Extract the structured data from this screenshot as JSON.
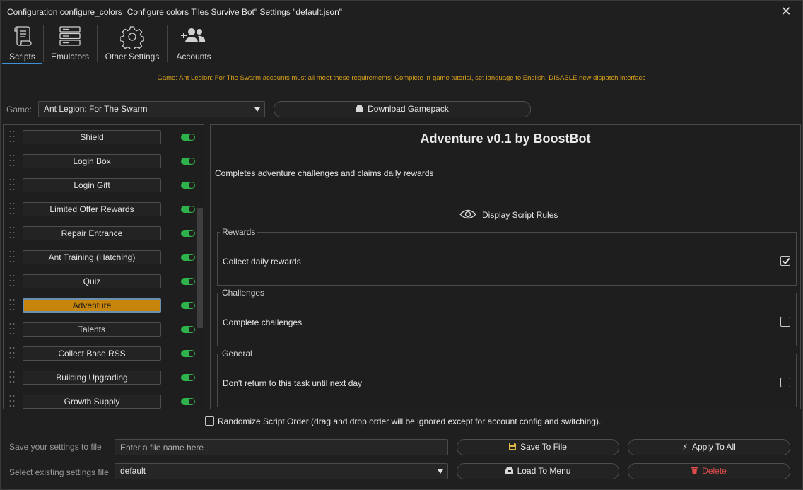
{
  "window": {
    "title": "Configuration configure_colors=Configure colors Tiles Survive Bot\" Settings \"default.json\"",
    "close_glyph": "✕"
  },
  "toolbar": {
    "items": [
      {
        "label": "Scripts",
        "icon": "scroll-icon",
        "active": true
      },
      {
        "label": "Emulators",
        "icon": "server-icon",
        "active": false
      },
      {
        "label": "Other Settings",
        "icon": "gear-icon",
        "active": false
      },
      {
        "label": "Accounts",
        "icon": "add-users-icon",
        "active": false
      }
    ]
  },
  "notice": "Game: Ant Legion: For The Swarm accounts must all meet these requirements! Complete in-game tutorial, set language to English, DISABLE new dispatch interface",
  "game": {
    "label": "Game:",
    "selected": "Ant Legion: For The Swarm",
    "download_label": "Download Gamepack"
  },
  "scripts": [
    {
      "label": "Shield",
      "enabled": true,
      "selected": false
    },
    {
      "label": "Login Box",
      "enabled": true,
      "selected": false
    },
    {
      "label": "Login Gift",
      "enabled": true,
      "selected": false
    },
    {
      "label": "Limited Offer Rewards",
      "enabled": true,
      "selected": false
    },
    {
      "label": "Repair Entrance",
      "enabled": true,
      "selected": false
    },
    {
      "label": "Ant Training (Hatching)",
      "enabled": true,
      "selected": false
    },
    {
      "label": "Quiz",
      "enabled": true,
      "selected": false
    },
    {
      "label": "Adventure",
      "enabled": true,
      "selected": true
    },
    {
      "label": "Talents",
      "enabled": true,
      "selected": false
    },
    {
      "label": "Collect Base RSS",
      "enabled": true,
      "selected": false
    },
    {
      "label": "Building Upgrading",
      "enabled": true,
      "selected": false
    },
    {
      "label": "Growth Supply",
      "enabled": true,
      "selected": false
    }
  ],
  "detail": {
    "title": "Adventure v0.1 by BoostBot",
    "description": "Completes adventure challenges and claims daily rewards",
    "rules_label": "Display Script Rules",
    "groups": [
      {
        "legend": "Rewards",
        "option": "Collect daily rewards",
        "checked": true
      },
      {
        "legend": "Challenges",
        "option": "Complete challenges",
        "checked": false
      },
      {
        "legend": "General",
        "option": "Don't return to this task until next day",
        "checked": false
      }
    ]
  },
  "randomize": {
    "label": "Randomize Script Order (drag and drop order will be ignored except for account config and switching).",
    "checked": false
  },
  "save": {
    "label": "Save your settings to file",
    "placeholder": "Enter a file name here",
    "value": "",
    "save_button": "Save To File",
    "apply_button": "Apply To All"
  },
  "load": {
    "label": "Select existing settings file",
    "selected": "default",
    "load_button": "Load To Menu",
    "delete_button": "Delete"
  },
  "colors": {
    "accent": "#3d8fd6",
    "selected_script": "#c7860b",
    "toggle_on": "#2fb24b",
    "notice": "#d9a21b",
    "danger": "#e04b4b"
  }
}
